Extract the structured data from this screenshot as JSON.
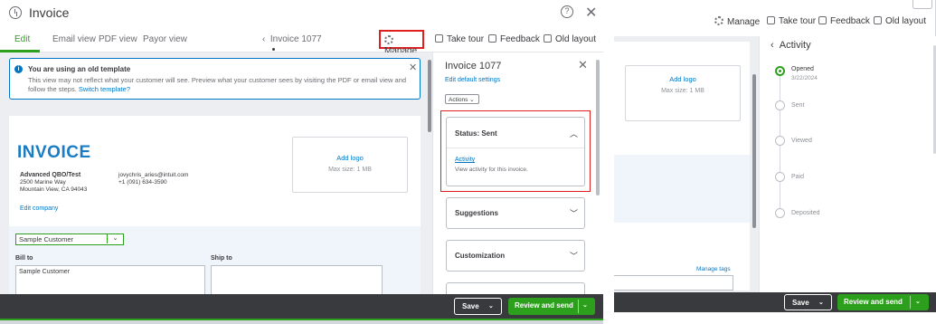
{
  "left": {
    "window_title": "Invoice",
    "tabs": [
      "Edit",
      "Email view",
      "PDF view",
      "Payor view"
    ],
    "invoice_nav": "Invoice 1077",
    "toolbar": {
      "manage": "Manage",
      "take_tour": "Take tour",
      "feedback": "Feedback",
      "old_layout": "Old layout"
    },
    "notice": {
      "title": "You are using an old template",
      "body": "This view may not reflect what your customer will see. Preview what your customer sees by visiting the PDF or email view and follow the steps.",
      "link": "Switch template?"
    },
    "invoice": {
      "heading": "INVOICE",
      "logo_add": "Add logo",
      "logo_max": "Max size: 1 MB",
      "company_name": "Advanced QBO/Test",
      "address_line1": "2500 Marine Way",
      "address_line2": "Mountain View, CA 94043",
      "email": "jovychris_aries@intuit.com",
      "phone": "+1 (091) 634-3590",
      "edit_company": "Edit company",
      "customer_select": "Sample Customer",
      "bill_to_label": "Bill to",
      "ship_to_label": "Ship to",
      "bill_to_value": "Sample Customer"
    },
    "side": {
      "title": "Invoice 1077",
      "edit_defaults": "Edit default settings",
      "actions": "Actions",
      "status_title": "Status: Sent",
      "activity_link": "Activity",
      "activity_desc": "View activity for this invoice.",
      "suggestions": "Suggestions",
      "customization": "Customization"
    },
    "footer": {
      "save": "Save",
      "review_send": "Review and send"
    }
  },
  "right": {
    "toolbar": {
      "manage": "Manage",
      "take_tour": "Take tour",
      "feedback": "Feedback",
      "old_layout": "Old layout"
    },
    "logo_add": "Add logo",
    "logo_max": "Max size: 1 MB",
    "manage_tags": "Manage tags",
    "activity": {
      "title": "Activity",
      "steps": [
        {
          "label": "Opened",
          "date": "3/22/2024",
          "done": true
        },
        {
          "label": "Sent",
          "date": "",
          "done": false
        },
        {
          "label": "Viewed",
          "date": "",
          "done": false
        },
        {
          "label": "Paid",
          "date": "",
          "done": false
        },
        {
          "label": "Deposited",
          "date": "",
          "done": false
        }
      ]
    },
    "footer": {
      "save": "Save",
      "review_send": "Review and send"
    }
  },
  "colors": {
    "accent_green": "#2ca01c",
    "link_blue": "#0077c5",
    "invoice_blue": "#1a7cc4",
    "highlight_red": "#e02020",
    "footer_dark": "#393a3d"
  }
}
